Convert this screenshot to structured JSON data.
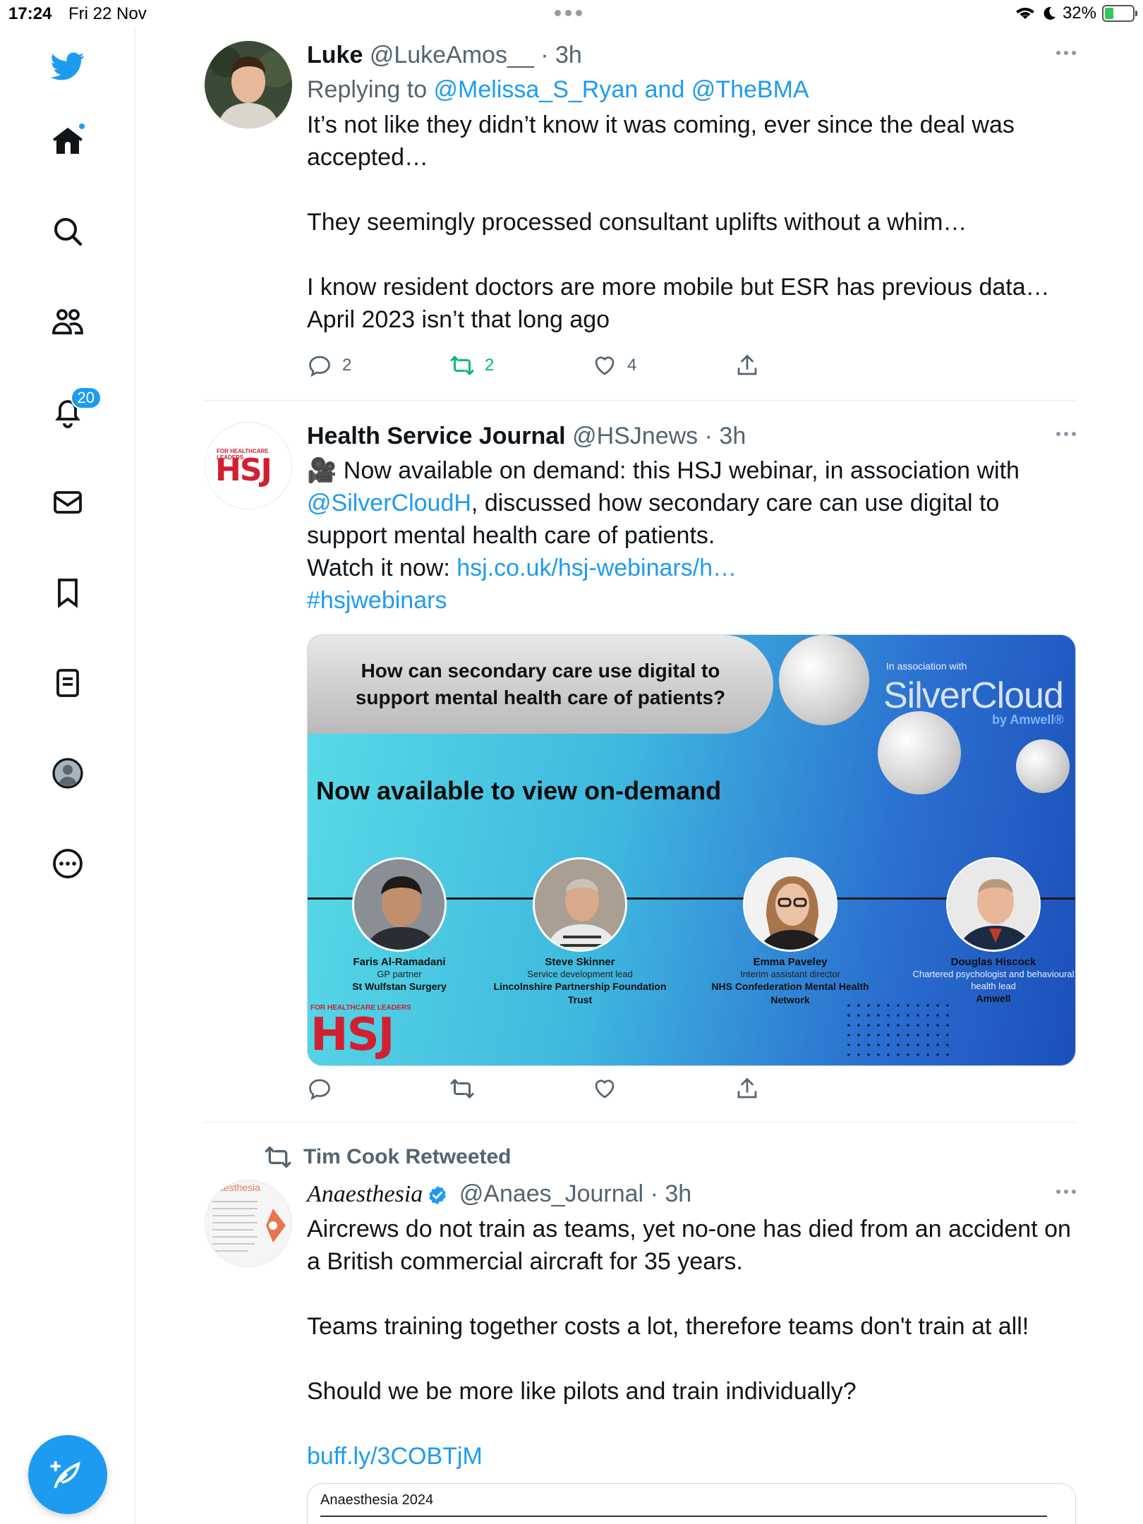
{
  "status_bar": {
    "time": "17:24",
    "date": "Fri 22 Nov",
    "battery": "32%",
    "battery_level": 0.32
  },
  "sidebar": {
    "items": [
      {
        "name": "twitter-logo",
        "icon": "bird-icon"
      },
      {
        "name": "home",
        "icon": "home-icon"
      },
      {
        "name": "explore",
        "icon": "search-icon"
      },
      {
        "name": "communities",
        "icon": "communities-icon"
      },
      {
        "name": "notifications",
        "icon": "bell-icon",
        "badge": "20"
      },
      {
        "name": "messages",
        "icon": "mail-icon"
      },
      {
        "name": "bookmarks",
        "icon": "bookmark-icon"
      },
      {
        "name": "lists",
        "icon": "list-icon"
      },
      {
        "name": "profile",
        "icon": "avatar-icon"
      },
      {
        "name": "more",
        "icon": "more-circle-icon"
      }
    ],
    "compose": "compose-icon"
  },
  "tweets": [
    {
      "name": "Luke",
      "handle": "@LukeAmos__",
      "time": "· 3h",
      "replying_prefix": "Replying to ",
      "replying_to": "@Melissa_S_Ryan and @TheBMA",
      "text": "It’s not like they didn’t know it was coming, ever since the deal was accepted…\n\nThey seemingly processed consultant uplifts without a whim…\n\nI know resident doctors are more mobile but ESR has previous data… April 2023 isn’t that long ago",
      "replies": "2",
      "retweets": "2",
      "likes": "4"
    },
    {
      "name": "Health Service Journal",
      "handle": "@HSJnews",
      "time": "· 3h",
      "avatar_small": "FOR HEALTHCARE LEADERS",
      "avatar_logo": "HSJ",
      "text_1": "🎥 Now available on demand: this HSJ webinar, in association with",
      "mention": "@SilverCloudH",
      "text_2": ", discussed how secondary care can use digital to support mental health care of patients.",
      "text_3": "Watch it now: ",
      "url": "hsj.co.uk/hsj-webinars/h…",
      "hashtag": "#hsjwebinars",
      "card": {
        "question": "How can secondary care use digital to support mental health care of patients?",
        "assoc": "In association with",
        "brand": "SilverCloud",
        "brand_sub": "by Amwell®",
        "headline": "Now available to view on-demand",
        "hsj_small": "FOR HEALTHCARE LEADERS",
        "hsj": "HSJ",
        "speakers": [
          {
            "name": "Faris Al-Ramadani",
            "role": "GP partner",
            "org": "St Wulfstan Surgery"
          },
          {
            "name": "Steve Skinner",
            "role": "Service development lead",
            "org": "Lincolnshire Partnership Foundation Trust"
          },
          {
            "name": "Emma Paveley",
            "role": "Interim assistant director",
            "org": "NHS Confederation Mental Health Network"
          },
          {
            "name": "Douglas Hiscock",
            "role": "Chartered psychologist and behavioural health lead",
            "org": "Amwell"
          }
        ]
      }
    },
    {
      "retweeted_by": "Tim Cook Retweeted",
      "name": "Anaesthesia",
      "handle": "@Anaes_Journal",
      "time": "· 3h",
      "avatar_text": "aesthesia",
      "text": "Aircrews do not train as teams, yet no-one has died from an accident on a British commercial aircraft for 35 years.\n\nTeams training together costs a lot, therefore teams don't train at all!\n\nShould we be more like pilots and train individually?",
      "url": "buff.ly/3COBTjM",
      "link_card_title": "Anaesthesia 2024"
    }
  ],
  "colors": {
    "accent": "#1d9bf0",
    "retweet": "#00ba7c",
    "muted": "#536471"
  }
}
